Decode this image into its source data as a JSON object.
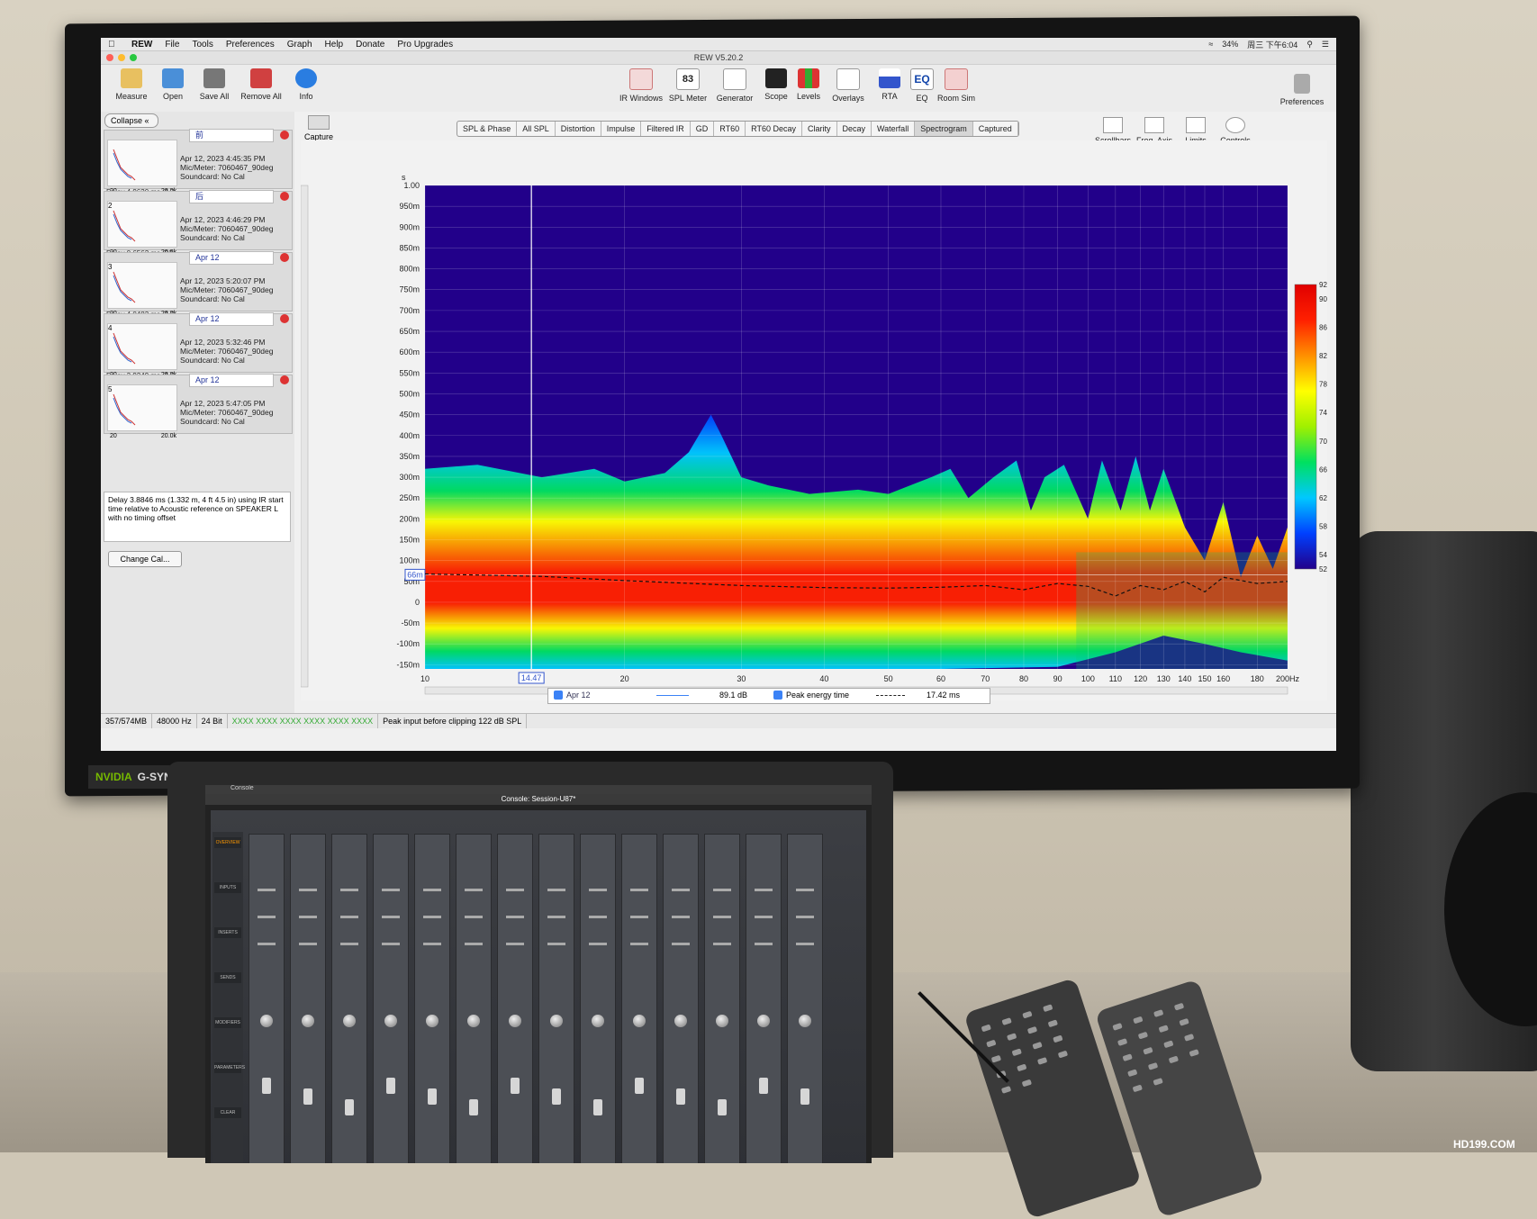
{
  "menubar": {
    "app": "REW",
    "items": [
      "File",
      "Tools",
      "Preferences",
      "Graph",
      "Help",
      "Donate",
      "Pro Upgrades"
    ],
    "status": [
      "34%",
      "周三 下午6:04"
    ]
  },
  "window_title": "REW V5.20.2",
  "toolbar_left": [
    {
      "label": "Measure",
      "icon": "microphone-icon"
    },
    {
      "label": "Open",
      "icon": "folder-icon"
    },
    {
      "label": "Save All",
      "icon": "save-icon"
    },
    {
      "label": "Remove All",
      "icon": "remove-icon"
    },
    {
      "label": "Info",
      "icon": "info-icon"
    }
  ],
  "toolbar_mid": [
    {
      "label": "IR Windows",
      "icon": "ir-windows-icon"
    },
    {
      "label": "SPL Meter",
      "icon": "spl-meter-icon",
      "value": "83"
    },
    {
      "label": "Generator",
      "icon": "generator-icon"
    },
    {
      "label": "Scope",
      "icon": "scope-icon"
    },
    {
      "label": "Levels",
      "icon": "levels-icon"
    },
    {
      "label": "Overlays",
      "icon": "overlays-icon"
    },
    {
      "label": "RTA",
      "icon": "rta-icon"
    },
    {
      "label": "EQ",
      "icon": "eq-icon"
    },
    {
      "label": "Room Sim",
      "icon": "room-sim-icon"
    }
  ],
  "preferences_label": "Preferences",
  "collapse_label": "Collapse",
  "measurements": [
    {
      "name": "前",
      "date": "Apr 12, 2023 4:45:35 PM",
      "mic": "Mic/Meter: 7060467_90deg",
      "sc": "Soundcard: No Cal",
      "delay": "Delay 4.9630 ms (1.7...",
      "n": ""
    },
    {
      "name": "后",
      "date": "Apr 12, 2023 4:46:29 PM",
      "mic": "Mic/Meter: 7060467_90deg",
      "sc": "Soundcard: No Cal",
      "delay": "Delay 0.6562 ms (22...",
      "n": "2"
    },
    {
      "name": "Apr 12",
      "date": "Apr 12, 2023 5:20:07 PM",
      "mic": "Mic/Meter: 7060467_90deg",
      "sc": "Soundcard: No Cal",
      "delay": "Delay 4.0483 ms (1.3...",
      "n": "3"
    },
    {
      "name": "Apr 12",
      "date": "Apr 12, 2023 5:32:46 PM",
      "mic": "Mic/Meter: 7060467_90deg",
      "sc": "Soundcard: No Cal",
      "delay": "Delay 3.9249 ms (1.3...",
      "n": "4"
    },
    {
      "name": "Apr 12",
      "date": "Apr 12, 2023 5:47:05 PM",
      "mic": "Mic/Meter: 7060467_90deg",
      "sc": "Soundcard: No Cal",
      "delay": "",
      "n": "5"
    }
  ],
  "thumb_axis": [
    "20",
    "20.0k"
  ],
  "note": "Delay 3.8846 ms (1.332 m, 4 ft 4.5 in) using IR start time relative to Acoustic reference on SPEAKER L with no timing offset",
  "change_cal": "Change Cal...",
  "capture_label": "Capture",
  "tabs": [
    "SPL & Phase",
    "All SPL",
    "Distortion",
    "Impulse",
    "Filtered IR",
    "GD",
    "RT60",
    "RT60 Decay",
    "Clarity",
    "Decay",
    "Waterfall",
    "Spectrogram",
    "Captured"
  ],
  "selected_tab": "Spectrogram",
  "right_tools": [
    "Scrollbars",
    "Freq. Axis",
    "Limits",
    "Controls"
  ],
  "chart_data": {
    "type": "heatmap",
    "title": "",
    "xlabel": "",
    "ylabel": "",
    "x_scale": "log",
    "xlim": [
      10,
      200
    ],
    "x_ticks": [
      "10",
      "20",
      "30",
      "40",
      "50",
      "60",
      "70",
      "80",
      "90",
      "100",
      "110",
      "120",
      "130",
      "140",
      "150",
      "160",
      "180",
      "200Hz"
    ],
    "x_tick_values": [
      10,
      20,
      30,
      40,
      50,
      60,
      70,
      80,
      90,
      100,
      110,
      120,
      130,
      140,
      150,
      160,
      180,
      200
    ],
    "y_ticks": [
      "1.00",
      "950m",
      "900m",
      "850m",
      "800m",
      "750m",
      "700m",
      "650m",
      "600m",
      "550m",
      "500m",
      "450m",
      "400m",
      "350m",
      "300m",
      "250m",
      "200m",
      "150m",
      "100m",
      "50m",
      "0",
      "-50m",
      "-100m",
      "-150m"
    ],
    "ylim_s": [
      -0.16,
      1.0
    ],
    "y_unit": "s",
    "cursor_x": "14.47",
    "cursor_y": "66m",
    "colorbar_ticks": [
      "92",
      "90",
      "86",
      "82",
      "78",
      "74",
      "70",
      "66",
      "62",
      "58",
      "54",
      "52"
    ],
    "colorbar_range_db": [
      52,
      92
    ],
    "peak_energy_time_curve": {
      "x": [
        10,
        15,
        20,
        30,
        40,
        50,
        60,
        70,
        80,
        90,
        100,
        110,
        120,
        130,
        140,
        150,
        160,
        180,
        200
      ],
      "y": [
        0.068,
        0.062,
        0.052,
        0.04,
        0.035,
        0.034,
        0.036,
        0.04,
        0.03,
        0.045,
        0.038,
        0.015,
        0.04,
        0.03,
        0.05,
        0.025,
        0.06,
        0.045,
        0.05
      ]
    },
    "legend": [
      {
        "name": "Apr 12",
        "value": "89.1 dB",
        "checked": true
      },
      {
        "name": "Peak energy time",
        "value": "17.42 ms",
        "checked": true
      }
    ],
    "colormap": [
      "#22008a",
      "#0040ff",
      "#00c8ff",
      "#00e060",
      "#a0f000",
      "#ffff00",
      "#ff9000",
      "#ff2000",
      "#e00000"
    ]
  },
  "statusbar": [
    "357/574MB",
    "48000 Hz",
    "24 Bit",
    "XXXX XXXX  XXXX XXXX  XXXX XXXX",
    "Peak input before clipping 122 dB SPL"
  ],
  "monitor_brand": {
    "nvidia": "NVIDIA",
    "gsync": "G-SYNC"
  },
  "laptop": {
    "app": "Console",
    "title": "Console: Session-U87*",
    "sidebar": [
      "OVERVIEW",
      "INPUTS",
      "INSERTS",
      "SENDS",
      "MODIFIERS",
      "PARAMETERS",
      "CLEAR"
    ]
  },
  "watermark": "HD199.COM"
}
